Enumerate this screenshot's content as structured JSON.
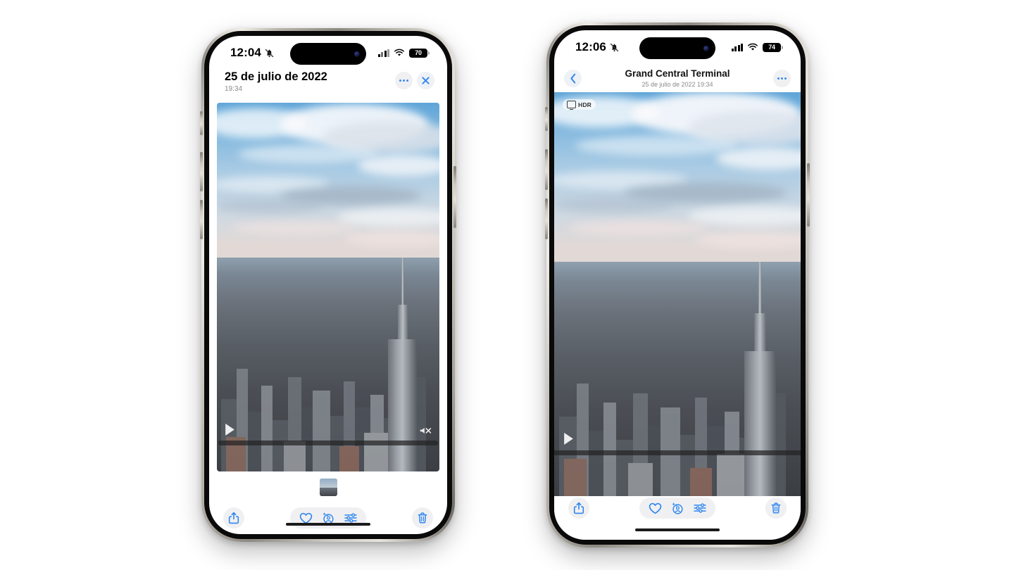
{
  "background_color": "#ffffff",
  "accent_color": "#3b8aee",
  "phones": [
    {
      "id": "phone-left",
      "status_bar": {
        "time": "12:04",
        "silent_mode_icon": "bell-slash-icon",
        "cellular_icon": "cellular-bars-icon",
        "wifi_icon": "wifi-icon",
        "battery_level": "70",
        "battery_icon": "battery-icon"
      },
      "nav": {
        "title": "25 de julio de 2022",
        "subtitle": "19:34",
        "more_button_label": "•••",
        "more_icon": "ellipsis-icon",
        "close_icon": "close-x-icon"
      },
      "photo": {
        "alt": "Vista aérea del horizonte de Nueva York con el Empire State Building",
        "play_icon": "play-triangle-icon",
        "mute_icon": "speaker-mute-icon",
        "scrubber_name": "video-scrubber"
      },
      "filmstrip": {
        "thumb_name": "filmstrip-thumbnail"
      },
      "toolbar": {
        "share_icon": "share-square-arrow-up-icon",
        "favorite_icon": "heart-icon",
        "live_photo_icon": "live-photo-sparkle-icon",
        "adjust_icon": "adjustments-sliders-icon",
        "delete_icon": "trash-icon"
      }
    },
    {
      "id": "phone-right",
      "status_bar": {
        "time": "12:06",
        "silent_mode_icon": "bell-slash-icon",
        "cellular_icon": "cellular-bars-icon",
        "wifi_icon": "wifi-icon",
        "battery_level": "74",
        "battery_icon": "battery-icon"
      },
      "nav": {
        "back_icon": "chevron-left-icon",
        "title": "Grand Central Terminal",
        "subtitle": "25 de julio de 2022  19:34",
        "more_icon": "ellipsis-icon"
      },
      "photo": {
        "alt": "Vista aérea del horizonte de Nueva York con el Empire State Building",
        "hdr_badge": "HDR",
        "hdr_icon": "display-monitor-icon",
        "play_icon": "play-triangle-icon",
        "scrubber_name": "video-scrubber"
      },
      "toolbar": {
        "share_icon": "share-square-arrow-up-icon",
        "favorite_icon": "heart-icon",
        "live_photo_icon": "live-photo-sparkle-icon",
        "adjust_icon": "adjustments-sliders-icon",
        "delete_icon": "trash-icon"
      }
    }
  ]
}
